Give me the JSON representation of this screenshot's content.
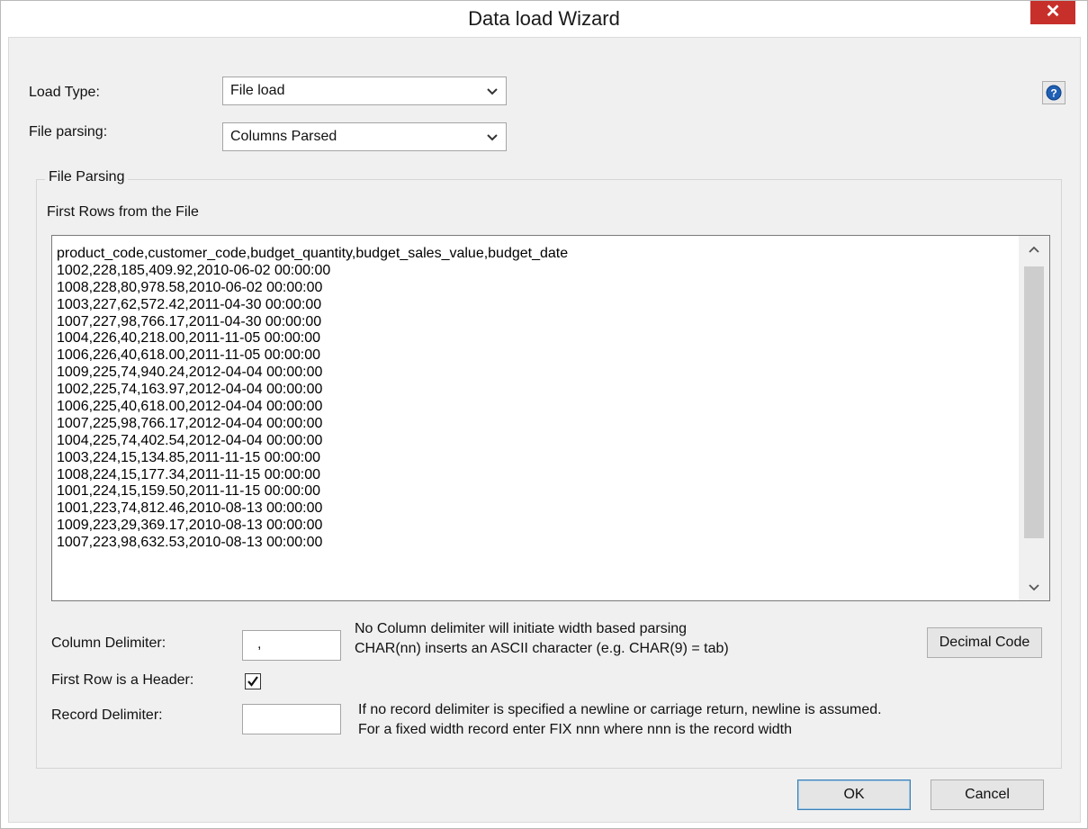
{
  "window": {
    "title": "Data load Wizard",
    "close_label": "✕"
  },
  "load_type": {
    "label": "Load Type:",
    "value": "File load"
  },
  "file_parsing_select": {
    "label": "File parsing:",
    "value": "Columns Parsed"
  },
  "help": {
    "icon": "help-icon"
  },
  "parsing_group": {
    "legend": "File Parsing",
    "first_rows_label": "First Rows from the File",
    "rows": [
      "product_code,customer_code,budget_quantity,budget_sales_value,budget_date",
      "1002,228,185,409.92,2010-06-02 00:00:00",
      "1008,228,80,978.58,2010-06-02 00:00:00",
      "1003,227,62,572.42,2011-04-30 00:00:00",
      "1007,227,98,766.17,2011-04-30 00:00:00",
      "1004,226,40,218.00,2011-11-05 00:00:00",
      "1006,226,40,618.00,2011-11-05 00:00:00",
      "1009,225,74,940.24,2012-04-04 00:00:00",
      "1002,225,74,163.97,2012-04-04 00:00:00",
      "1006,225,40,618.00,2012-04-04 00:00:00",
      "1007,225,98,766.17,2012-04-04 00:00:00",
      "1004,225,74,402.54,2012-04-04 00:00:00",
      "1003,224,15,134.85,2011-11-15 00:00:00",
      "1008,224,15,177.34,2011-11-15 00:00:00",
      "1001,224,15,159.50,2011-11-15 00:00:00",
      "1001,223,74,812.46,2010-08-13 00:00:00",
      "1009,223,29,369.17,2010-08-13 00:00:00",
      "1007,223,98,632.53,2010-08-13 00:00:00"
    ],
    "column_delimiter": {
      "label": "Column Delimiter:",
      "value": ",",
      "hint_line1": "No Column delimiter will initiate width based parsing",
      "hint_line2": "CHAR(nn) inserts an ASCII character (e.g. CHAR(9) = tab)"
    },
    "decimal_code_button": "Decimal Code",
    "first_row_header": {
      "label": "First Row is a Header:",
      "checked": true
    },
    "record_delimiter": {
      "label": "Record Delimiter:",
      "value": "",
      "hint_line1": "If no record delimiter is specified a newline or carriage return, newline is assumed.",
      "hint_line2": "For a fixed width record enter FIX nnn where nnn is the record width"
    }
  },
  "buttons": {
    "ok": "OK",
    "cancel": "Cancel"
  },
  "colors": {
    "close_button": "#c7302a",
    "dialog_bg": "#f0f0f0",
    "help_icon": "#1f5fb4"
  }
}
